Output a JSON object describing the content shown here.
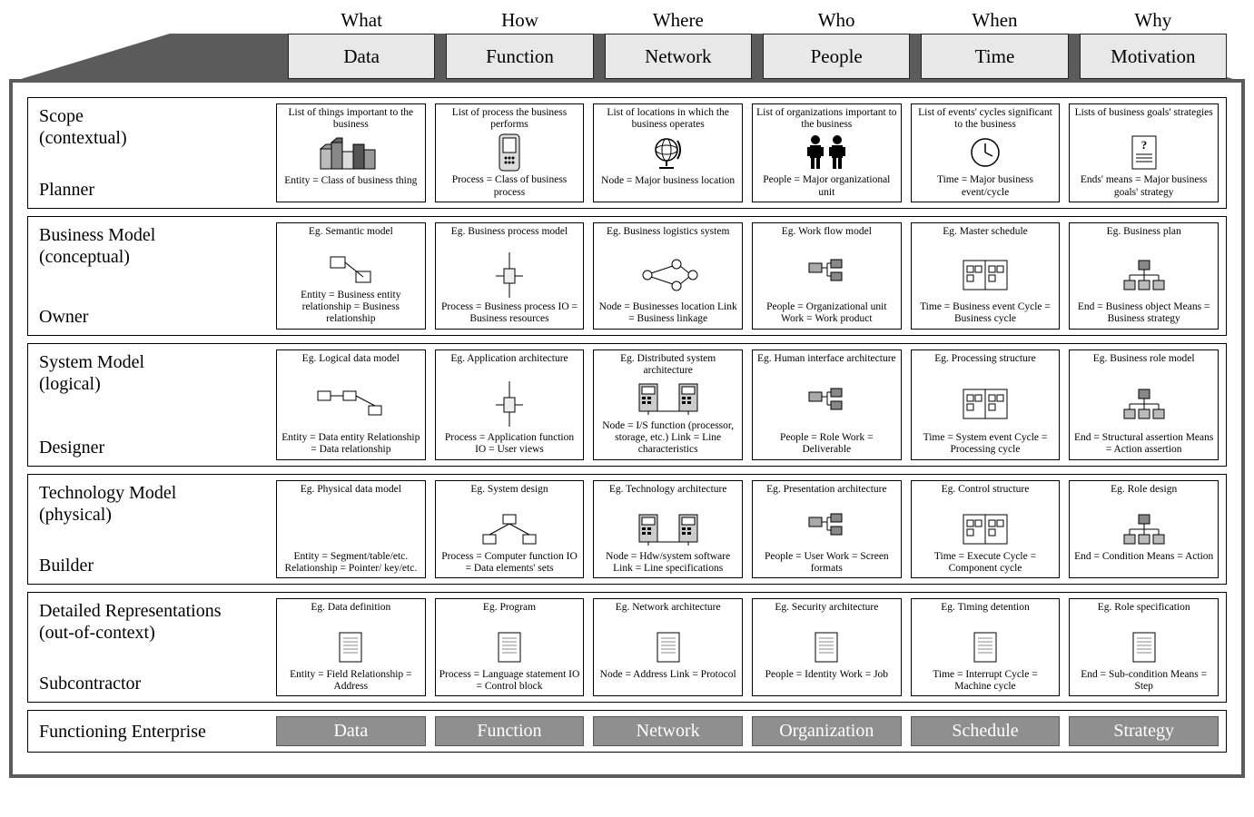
{
  "questions": [
    "What",
    "How",
    "Where",
    "Who",
    "When",
    "Why"
  ],
  "tabs": [
    "Data",
    "Function",
    "Network",
    "People",
    "Time",
    "Motivation"
  ],
  "footer": [
    "Data",
    "Function",
    "Network",
    "Organization",
    "Schedule",
    "Strategy"
  ],
  "footer_title": "Functioning Enterprise",
  "rows": [
    {
      "title": "Scope",
      "subtitle": "(contextual)",
      "role": "Planner",
      "cells": [
        {
          "top": "List of things important to the business",
          "bot": "Entity = Class of business thing",
          "icon": "buildings"
        },
        {
          "top": "List of process the business performs",
          "bot": "Process = Class of business process",
          "icon": "device"
        },
        {
          "top": "List of locations in which the business operates",
          "bot": "Node = Major business location",
          "icon": "globe"
        },
        {
          "top": "List of organizations important to the business",
          "bot": "People = Major organizational unit",
          "icon": "people"
        },
        {
          "top": "List of events' cycles significant to the business",
          "bot": "Time = Major business event/cycle",
          "icon": "clock"
        },
        {
          "top": "Lists of business goals' strategies",
          "bot": "Ends' means = Major business goals' strategy",
          "icon": "doc-q"
        }
      ]
    },
    {
      "title": "Business Model",
      "subtitle": "(conceptual)",
      "role": "Owner",
      "cells": [
        {
          "top": "Eg. Semantic model",
          "bot": "Entity = Business entity relationship = Business relationship",
          "icon": "er2"
        },
        {
          "top": "Eg. Business process model",
          "bot": "Process = Business process IO = Business resources",
          "icon": "flow-v"
        },
        {
          "top": "Eg. Business logistics system",
          "bot": "Node = Businesses location Link = Business linkage",
          "icon": "graph"
        },
        {
          "top": "Eg. Work flow model",
          "bot": "People = Organizational unit Work = Work product",
          "icon": "org"
        },
        {
          "top": "Eg. Master schedule",
          "bot": "Time = Business event Cycle = Business cycle",
          "icon": "sched"
        },
        {
          "top": "Eg. Business plan",
          "bot": "End = Business object Means = Business strategy",
          "icon": "tree"
        }
      ]
    },
    {
      "title": "System Model",
      "subtitle": "(logical)",
      "role": "Designer",
      "cells": [
        {
          "top": "Eg. Logical data model",
          "bot": "Entity = Data entity Relationship = Data relationship",
          "icon": "er3"
        },
        {
          "top": "Eg. Application architecture",
          "bot": "Process = Application function IO = User views",
          "icon": "flow-v"
        },
        {
          "top": "Eg. Distributed system architecture",
          "bot": "Node = I/S function (processor, storage, etc.) Link = Line characteristics",
          "icon": "servers"
        },
        {
          "top": "Eg. Human interface architecture",
          "bot": "People = Role Work = Deliverable",
          "icon": "org"
        },
        {
          "top": "Eg. Processing structure",
          "bot": "Time = System event Cycle = Processing cycle",
          "icon": "sched"
        },
        {
          "top": "Eg. Business role model",
          "bot": "End = Structural assertion Means = Action assertion",
          "icon": "tree"
        }
      ]
    },
    {
      "title": "Technology Model",
      "subtitle": "(physical)",
      "role": "Builder",
      "cells": [
        {
          "top": "Eg. Physical data model",
          "bot": "Entity = Segment/table/etc.  Relationship = Pointer/ key/etc.",
          "icon": "none"
        },
        {
          "top": "Eg. System design",
          "bot": "Process = Computer function IO = Data elements' sets",
          "icon": "hub"
        },
        {
          "top": "Eg. Technology architecture",
          "bot": "Node = Hdw/system software Link = Line specifications",
          "icon": "servers"
        },
        {
          "top": "Eg. Presentation architecture",
          "bot": "People = User Work = Screen formats",
          "icon": "org"
        },
        {
          "top": "Eg. Control structure",
          "bot": "Time = Execute Cycle = Component cycle",
          "icon": "sched"
        },
        {
          "top": "Eg. Role design",
          "bot": "End = Condition Means = Action",
          "icon": "tree"
        }
      ]
    },
    {
      "title": "Detailed Representations",
      "subtitle": "(out-of-context)",
      "role": "Subcontractor",
      "cells": [
        {
          "top": "Eg. Data definition",
          "bot": "Entity = Field Relationship = Address",
          "icon": "page"
        },
        {
          "top": "Eg. Program",
          "bot": "Process = Language statement IO = Control block",
          "icon": "page"
        },
        {
          "top": "Eg. Network architecture",
          "bot": "Node = Address Link = Protocol",
          "icon": "page"
        },
        {
          "top": "Eg. Security architecture",
          "bot": "People = Identity Work = Job",
          "icon": "page"
        },
        {
          "top": "Eg. Timing detention",
          "bot": "Time = Interrupt Cycle = Machine cycle",
          "icon": "page"
        },
        {
          "top": "Eg. Role specification",
          "bot": "End = Sub-condition Means = Step",
          "icon": "page"
        }
      ]
    }
  ]
}
